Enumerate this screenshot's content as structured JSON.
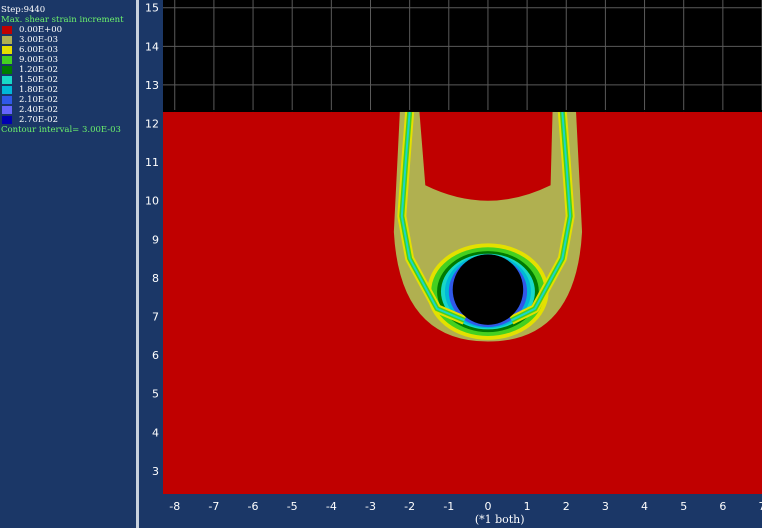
{
  "legend": {
    "step": "Step:9440",
    "title": "Max. shear strain increment",
    "entries": [
      {
        "label": "0.00E+00",
        "color": "#c00000"
      },
      {
        "label": "3.00E-03",
        "color": "#b0b050"
      },
      {
        "label": "6.00E-03",
        "color": "#e4e000"
      },
      {
        "label": "9.00E-03",
        "color": "#44d020"
      },
      {
        "label": "1.20E-02",
        "color": "#007a00"
      },
      {
        "label": "1.50E-02",
        "color": "#18d8c8"
      },
      {
        "label": "1.80E-02",
        "color": "#00b8d8"
      },
      {
        "label": "2.10E-02",
        "color": "#3058e8"
      },
      {
        "label": "2.40E-02",
        "color": "#6464ff"
      },
      {
        "label": "2.70E-02",
        "color": "#0000b0"
      }
    ],
    "interval": "Contour interval=  3.00E-03",
    "title_color": "#6cf26c",
    "text_color": "#ffffff"
  },
  "chart_data": {
    "type": "heatmap",
    "title": "",
    "xlabel": "(*1 both)",
    "ylabel": "",
    "xlim": [
      -8.3,
      7
    ],
    "ylim": [
      2.4,
      15.2
    ],
    "x_ticks": [
      -8,
      -7,
      -6,
      -5,
      -4,
      -3,
      -2,
      -1,
      0,
      1,
      2,
      3,
      4,
      5,
      6,
      7
    ],
    "y_ticks": [
      3,
      4,
      5,
      6,
      7,
      8,
      9,
      10,
      11,
      12,
      13,
      14,
      15
    ],
    "grid": true,
    "ground_surface_y": 12.3,
    "tunnel": {
      "center_x": 0,
      "center_y": 7.8,
      "radius": 0.9
    },
    "background_color": "#000000",
    "grid_color": "#5a5a5a",
    "contour_levels": [
      0,
      0.003,
      0.006,
      0.009,
      0.012,
      0.015,
      0.018,
      0.021,
      0.024,
      0.027
    ],
    "shear_bands": [
      {
        "side": "left",
        "points": [
          [
            -2.0,
            12.3
          ],
          [
            -2.1,
            11.0
          ],
          [
            -2.2,
            9.6
          ],
          [
            -2.0,
            8.5
          ],
          [
            -1.3,
            7.2
          ],
          [
            -0.6,
            6.9
          ]
        ]
      },
      {
        "side": "right",
        "points": [
          [
            1.9,
            12.3
          ],
          [
            2.0,
            11.0
          ],
          [
            2.1,
            9.6
          ],
          [
            1.9,
            8.5
          ],
          [
            1.2,
            7.2
          ],
          [
            0.6,
            6.9
          ]
        ]
      }
    ]
  }
}
